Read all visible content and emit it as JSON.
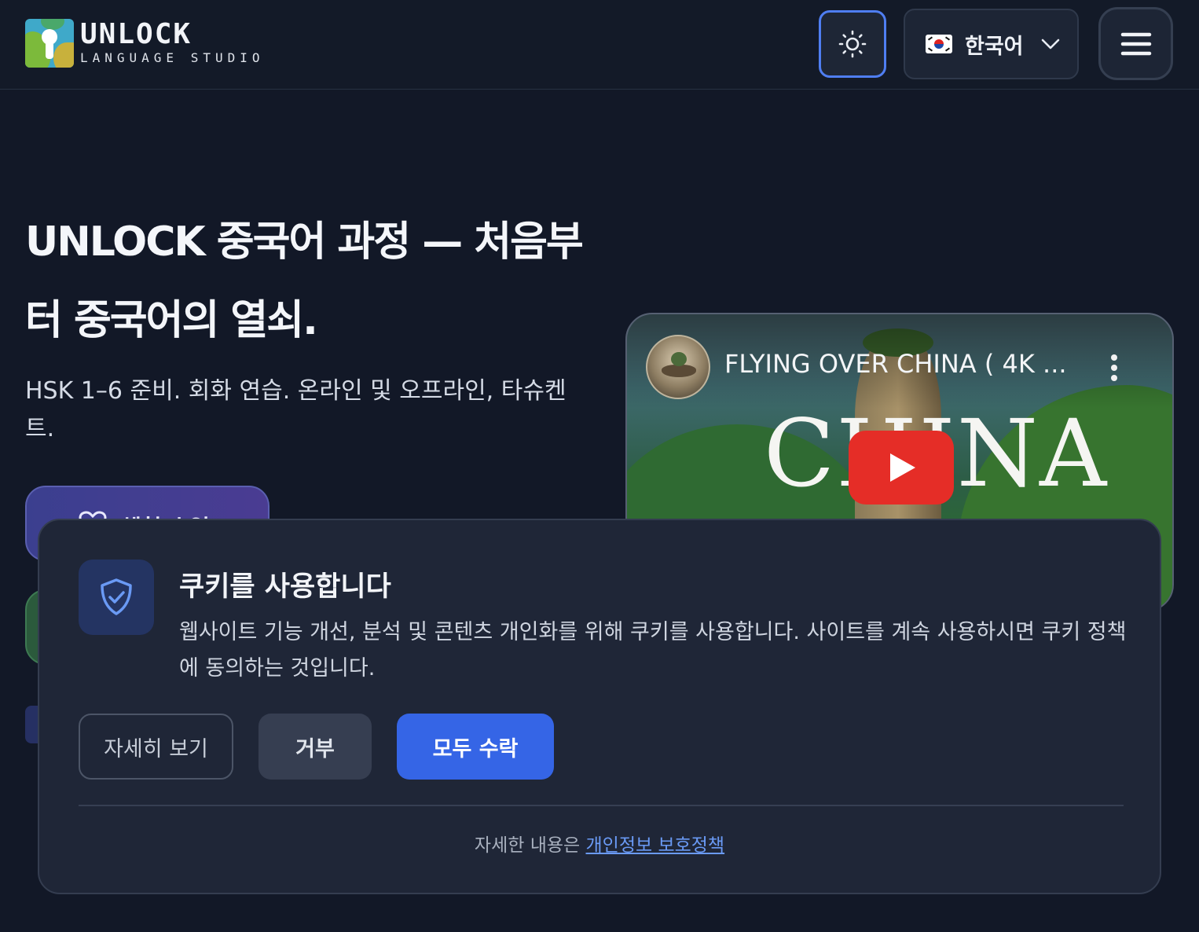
{
  "header": {
    "logo_title": "UNLOCK",
    "logo_subtitle": "LANGUAGE STUDIO",
    "language_label": "한국어"
  },
  "hero": {
    "title": "UNLOCK 중국어 과정 — 처음부터 중국어의 열쇠.",
    "subtitle": "HSK 1–6 준비. 회화 연습. 온라인 및 오프라인, 타슈켄트.",
    "primary_button_label": "체험 수업"
  },
  "video": {
    "title": "FLYING OVER CHINA ( 4K ...",
    "overlay_text": "CHINA"
  },
  "cookie_banner": {
    "title": "쿠키를 사용합니다",
    "text": "웹사이트 기능 개선, 분석 및 콘텐츠 개인화를 위해 쿠키를 사용합니다. 사이트를 계속 사용하시면 쿠키 정책에 동의하는 것입니다.",
    "details_label": "자세히 보기",
    "decline_label": "거부",
    "accept_label": "모두 수락",
    "privacy_prefix": "자세한 내용은 ",
    "privacy_link": "개인정보 보호정책"
  },
  "colors": {
    "background": "#121827",
    "accent": "#3565e6",
    "link": "#6a9af5",
    "youtube_red": "#e52d27"
  },
  "icons": [
    "sun-icon",
    "korea-flag-icon",
    "chevron-down-icon",
    "menu-icon",
    "heart-icon",
    "more-vertical-icon",
    "play-icon",
    "shield-check-icon"
  ]
}
